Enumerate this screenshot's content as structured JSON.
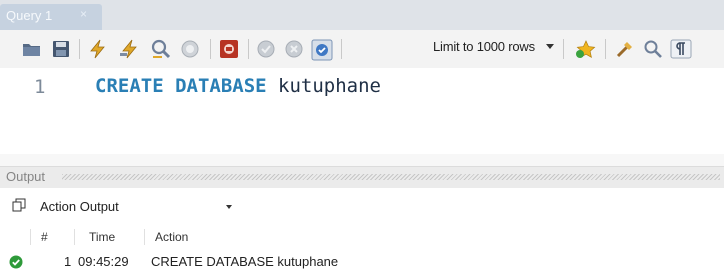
{
  "tabs": [
    {
      "label": "Query 1",
      "close_glyph": "×"
    }
  ],
  "toolbar": {
    "icons": [
      "open-folder-icon",
      "save-icon",
      "execute-icon",
      "execute-current-icon",
      "explain-icon",
      "stop-icon",
      "toggle-error-icon",
      "commit-icon",
      "rollback-icon",
      "autocommit-icon",
      "add-snippet-icon",
      "beautify-icon",
      "find-icon",
      "invisible-chars-icon"
    ],
    "limit_label": "Limit to 1000 rows"
  },
  "editor": {
    "lines": [
      {
        "number": "1",
        "keyword": "CREATE DATABASE",
        "rest": " kutuphane"
      }
    ]
  },
  "output": {
    "title": "Output",
    "selector": "Action Output",
    "columns": [
      "#",
      "Time",
      "Action"
    ],
    "rows": [
      {
        "status": "success",
        "index": "1",
        "time": "09:45:29",
        "action": "CREATE DATABASE kutuphane"
      }
    ]
  },
  "colors": {
    "keyword": "#2a7fb5",
    "tab_bg": "#c6d2e0",
    "success": "#2e9a3a"
  }
}
